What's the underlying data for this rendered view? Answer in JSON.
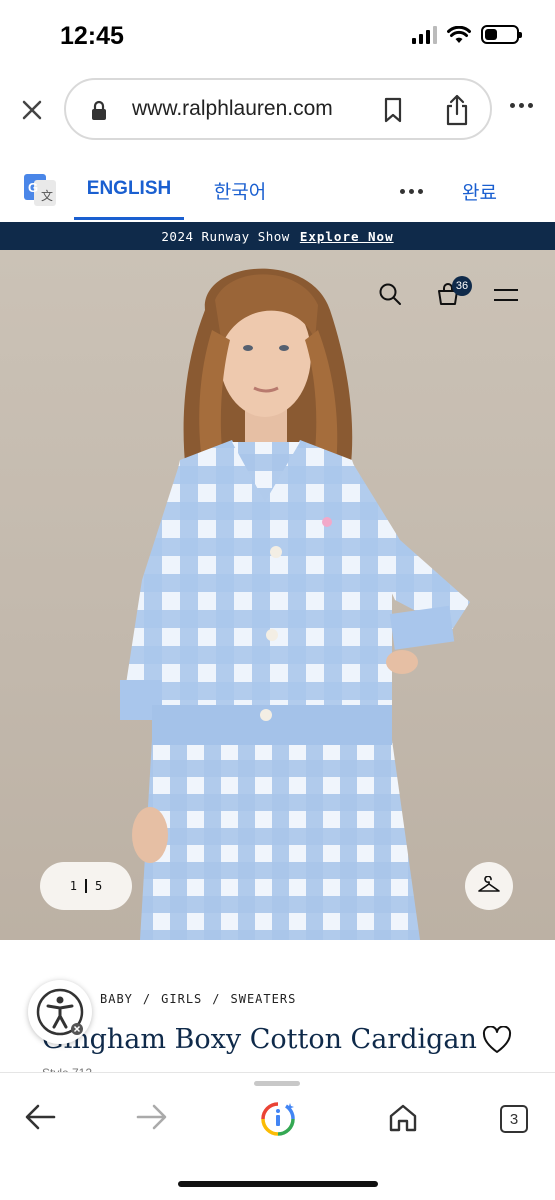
{
  "status_bar": {
    "time": "12:45"
  },
  "browser": {
    "url": "www.ralphlauren.com"
  },
  "translate_bar": {
    "tab_active": "ENGLISH",
    "tab_other": "한국어",
    "done": "완료"
  },
  "promo": {
    "text": "2024 Runway Show",
    "link": "Explore Now"
  },
  "header": {
    "cart_count": "36"
  },
  "gallery": {
    "current": "1",
    "total": "5"
  },
  "product": {
    "breadcrumb": [
      "BABY",
      "/",
      "GIRLS",
      "/",
      "SWEATERS"
    ],
    "title": "Gingham Boxy Cotton Cardigan",
    "style_line": "Style 712"
  },
  "toolbar": {
    "tab_count": "3"
  },
  "colors": {
    "navy": "#0f2a4a",
    "link_blue": "#1a5fd0",
    "gingham_blue": "#a9c6ec"
  },
  "icons": [
    "close-icon",
    "lock-icon",
    "bookmark-icon",
    "share-icon",
    "more-icon",
    "google-translate-icon",
    "search-icon",
    "cart-icon",
    "menu-icon",
    "hanger-icon",
    "heart-icon",
    "accessibility-icon",
    "back-icon",
    "forward-icon",
    "google-lens-icon",
    "home-icon"
  ]
}
